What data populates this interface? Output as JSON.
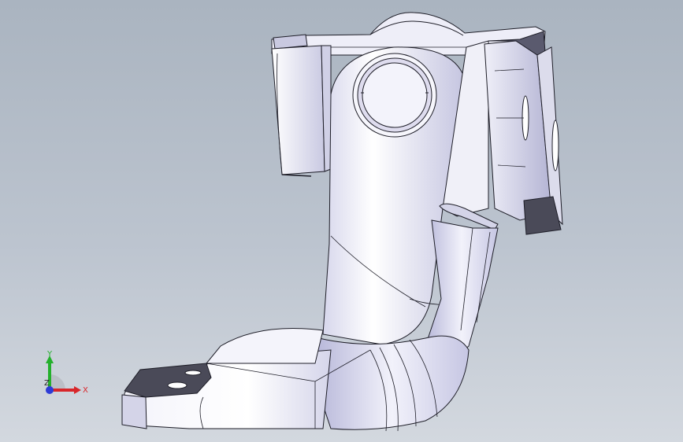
{
  "viewport": {
    "background_top": "#aab4c0",
    "background_bottom": "#d3d8df"
  },
  "model": {
    "face_color": "#e9e9f4",
    "shade_color": "#b8b8d6",
    "dark_color": "#4a4a58",
    "edge_color": "#1e1e28"
  },
  "triad": {
    "x_label": "X",
    "y_label": "Y",
    "z_label": "Z",
    "x_color": "#d8262a",
    "y_color": "#24b02c",
    "z_color": "#2d3bd6"
  }
}
